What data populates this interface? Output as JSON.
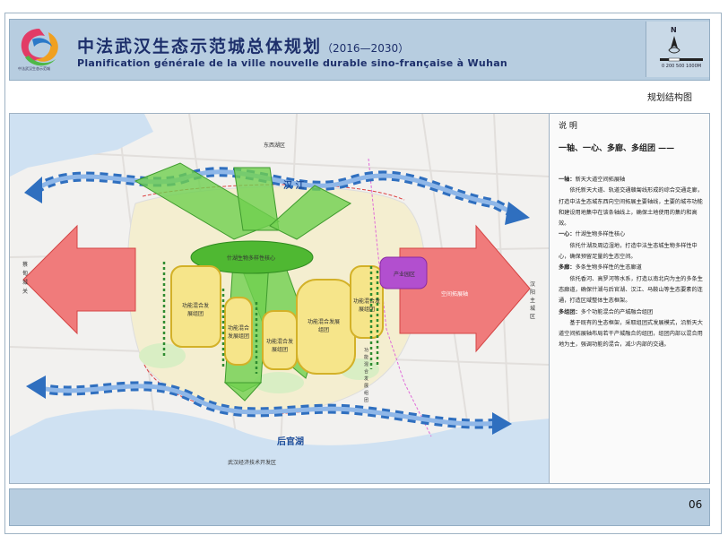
{
  "header": {
    "logo_text": "中法武汉生态示范城",
    "title_cn": "中法武汉生态示范城总体规划",
    "title_years": "（2016—2030）",
    "title_fr": "Planification générale de la ville nouvelle durable sino-française à Wuhan",
    "north_label": "N",
    "scale_label": "0    200  500      1000M"
  },
  "subtitle": "规划结构图",
  "map": {
    "label_dongxihu": "东西湖区",
    "label_hanjiang": "汉 江",
    "label_houguanhu": "后官湖",
    "label_dev_zone": "武汉经济技术开发区",
    "label_caidian": "蔡甸城关",
    "label_hanyang": "汉阳主城区",
    "label_core": "什湖生物多样性核心",
    "label_industrial": "产业园区",
    "label_axis": "空间拓展轴",
    "label_cluster_1": "功能混合发展组团",
    "label_cluster_2": "功能混合发展组团",
    "label_cluster_3": "功能混合发展组团",
    "label_cluster_4": "功能混合发展组团",
    "label_cluster_5": "功能混合发展组团",
    "label_cluster_6": "功能混合发展组团"
  },
  "panel": {
    "title": "说  明",
    "heading": "一轴、一心、多廊、多组团 ——",
    "paragraphs": [
      {
        "lead": "一轴：",
        "text": "新天大道空间拓展轴"
      },
      {
        "indent": "依托新天大道、轨道交通赣匐线形成的综合交通走廊，打造中法生态城东西向空间拓展主要轴线，主要的城市功能和建设用地集中在该条轴线上，确保土地使用的集约和高效。"
      },
      {
        "lead": "一心：",
        "text": "什湖生物多样性核心"
      },
      {
        "indent": "依托什湖及周边湿地，打造中法生态城生物多样性中心，确保预留足量的生态空间。"
      },
      {
        "lead": "多廊：",
        "text": "多条生物多样性的生态廊道"
      },
      {
        "indent": "依托香河、高罗河等水系，打造以南北向为主的多条生态廊道，确保什湖与后官湖、汉江、马鞍山等生态要素的连通，打造区域整体生态框架。"
      },
      {
        "lead": "多组团：",
        "text": "多个功能混合的产城融合组团"
      },
      {
        "indent": "基于既有的生态框架，采取组团式发展模式，沿新天大道空间拓展轴布局若干产城融合的组团，组团内部以混合用地为主，强调功能的混合，减少内部的交通。"
      }
    ]
  },
  "footer": {
    "page_number": "06"
  },
  "colors": {
    "header_bg": "#b7cde0",
    "arrow_red": "#f07b7b",
    "green_corridor": "#6fcf4f",
    "cluster_yellow": "#f6e58a",
    "industrial_purple": "#b24fcf",
    "river_blue": "#3a79c9"
  }
}
